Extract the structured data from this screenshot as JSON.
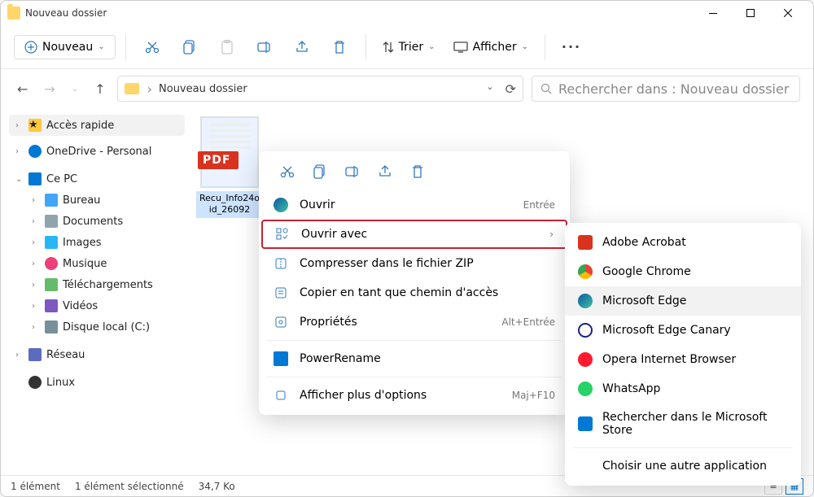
{
  "window": {
    "title": "Nouveau dossier"
  },
  "toolbar": {
    "new_label": "Nouveau",
    "sort_label": "Trier",
    "display_label": "Afficher"
  },
  "addressbar": {
    "path": "Nouveau dossier"
  },
  "search": {
    "placeholder": "Rechercher dans : Nouveau dossier"
  },
  "sidebar": {
    "quick_access": "Accès rapide",
    "onedrive": "OneDrive - Personal",
    "this_pc": "Ce PC",
    "items": {
      "desktop": "Bureau",
      "documents": "Documents",
      "images": "Images",
      "music": "Musique",
      "downloads": "Téléchargements",
      "videos": "Vidéos",
      "local_disk": "Disque local (C:)"
    },
    "network": "Réseau",
    "linux": "Linux"
  },
  "file": {
    "name": "Recu_Info24oid_26092",
    "badge": "PDF"
  },
  "context_menu": {
    "open": "Ouvrir",
    "open_shortcut": "Entrée",
    "open_with": "Ouvrir avec",
    "compress": "Compresser dans le fichier ZIP",
    "copy_path": "Copier en tant que chemin d'accès",
    "properties": "Propriétés",
    "properties_shortcut": "Alt+Entrée",
    "power_rename": "PowerRename",
    "more_options": "Afficher plus d'options",
    "more_options_shortcut": "Maj+F10"
  },
  "submenu": {
    "adobe": "Adobe Acrobat",
    "chrome": "Google Chrome",
    "edge": "Microsoft Edge",
    "edge_canary": "Microsoft Edge Canary",
    "opera": "Opera Internet Browser",
    "whatsapp": "WhatsApp",
    "store": "Rechercher dans le Microsoft Store",
    "other": "Choisir une autre application"
  },
  "status": {
    "count": "1 élément",
    "selection": "1 élément sélectionné",
    "size": "34,7 Ko"
  }
}
